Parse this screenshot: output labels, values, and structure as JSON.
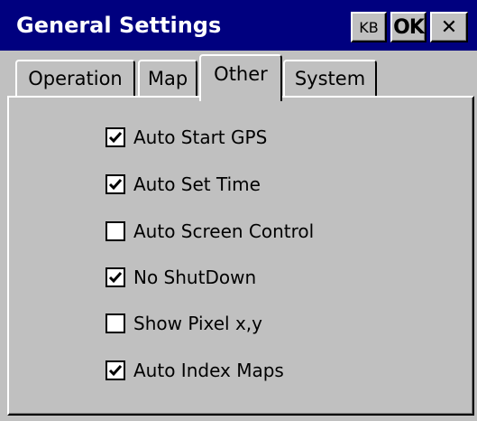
{
  "window": {
    "title": "General Settings",
    "buttons": {
      "kb_label": "KB",
      "ok_label": "OK",
      "close_label": "✕"
    }
  },
  "tabs": [
    {
      "label": "Operation",
      "selected": false
    },
    {
      "label": "Map",
      "selected": false
    },
    {
      "label": "Other",
      "selected": true
    },
    {
      "label": "System",
      "selected": false
    }
  ],
  "options": [
    {
      "label": "Auto Start GPS",
      "checked": true
    },
    {
      "label": "Auto Set Time",
      "checked": true
    },
    {
      "label": "Auto Screen Control",
      "checked": false
    },
    {
      "label": "No ShutDown",
      "checked": true
    },
    {
      "label": "Show Pixel x,y",
      "checked": false
    },
    {
      "label": "Auto Index Maps",
      "checked": true
    }
  ],
  "colors": {
    "titlebar": "#00007f",
    "face": "#c0c0c0"
  }
}
